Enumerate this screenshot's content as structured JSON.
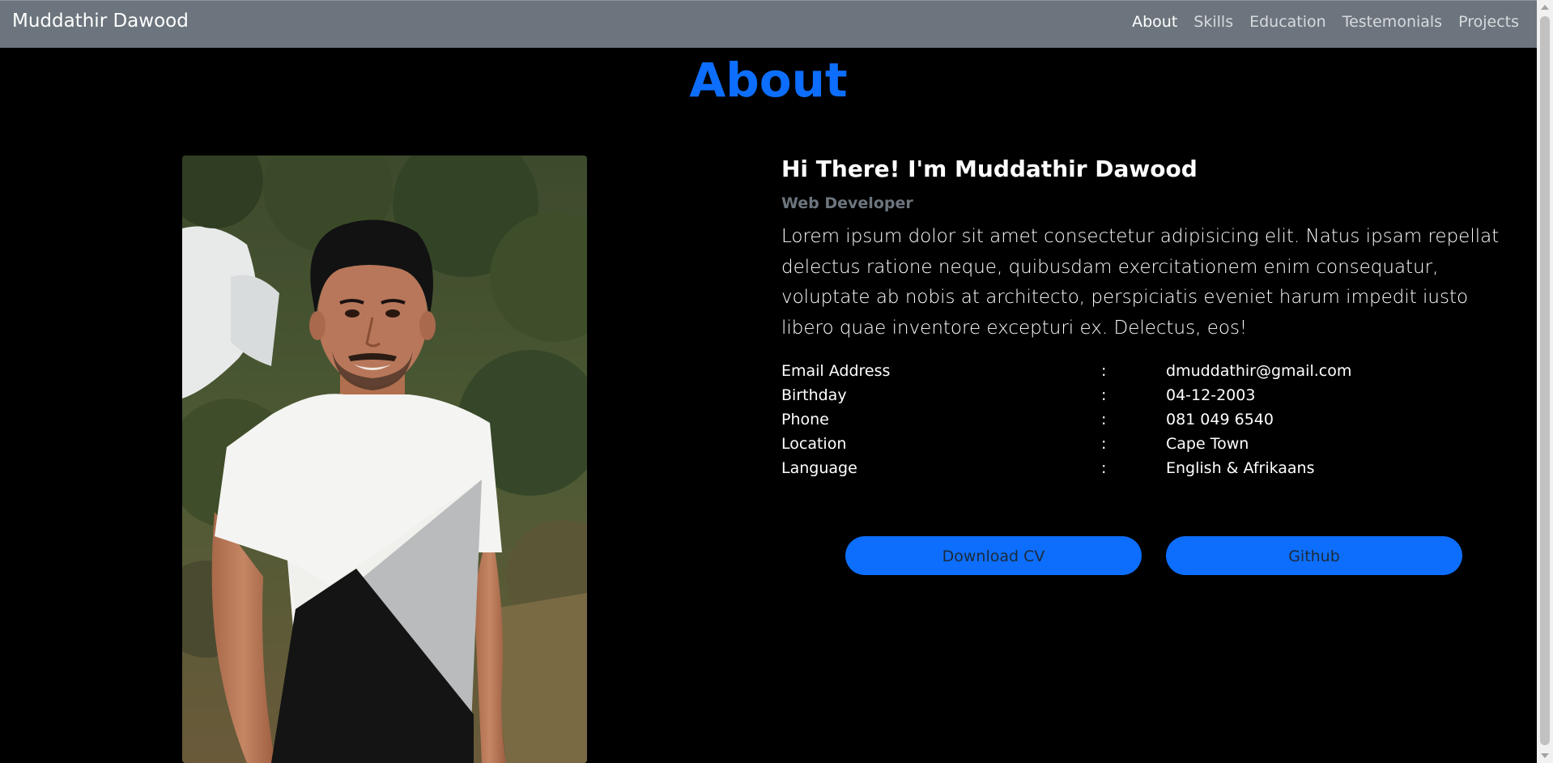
{
  "navbar": {
    "brand": "Muddathir Dawood",
    "links": [
      {
        "label": "About",
        "active": true
      },
      {
        "label": "Skills",
        "active": false
      },
      {
        "label": "Education",
        "active": false
      },
      {
        "label": "Testemonials",
        "active": false
      },
      {
        "label": "Projects",
        "active": false
      }
    ]
  },
  "about": {
    "title": "About",
    "heading": "Hi There! I'm Muddathir Dawood",
    "role": "Web Developer",
    "bio": "Lorem ipsum dolor sit amet consectetur adipisicing elit. Natus ipsam repellat delectus ratione neque, quibusdam exercitationem enim consequatur, voluptate ab nobis at architecto, perspiciatis eveniet harum impedit iusto libero quae inventore excepturi ex. Delectus, eos!",
    "details": [
      {
        "label": "Email Address",
        "value": "dmuddathir@gmail.com"
      },
      {
        "label": "Birthday",
        "value": "04-12-2003"
      },
      {
        "label": "Phone",
        "value": "081 049 6540"
      },
      {
        "label": "Location",
        "value": "Cape Town"
      },
      {
        "label": "Language",
        "value": "English & Afrikaans"
      }
    ],
    "separator": ":",
    "buttons": {
      "download_cv": "Download CV",
      "github": "Github"
    }
  },
  "colors": {
    "accent": "#0d6efd",
    "navbar_bg": "#6c757d",
    "page_bg": "#000000",
    "muted": "#6c757d"
  }
}
